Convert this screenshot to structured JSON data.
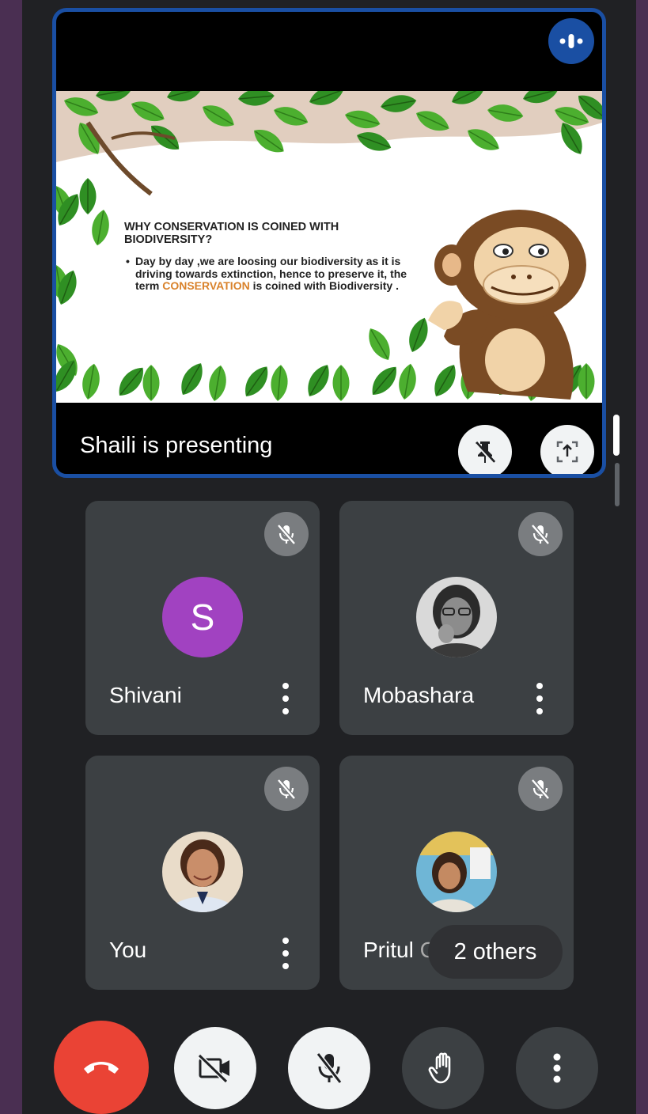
{
  "meeting": {
    "presenting_label": "Shaili is presenting"
  },
  "slide": {
    "title_line1": "WHY CONSERVATION IS COINED WITH",
    "title_line2": "BIODIVERSITY?",
    "bullet_marker": "•",
    "bullet_part1": "Day by day ,we are loosing our biodiversity as it is driving towards extinction, hence to preserve it, the term ",
    "bullet_accent": "CONSERVATION",
    "bullet_part2": " is coined with Biodiversity .",
    "accent_color": "#d9822b"
  },
  "participants": [
    {
      "name": "Shivani",
      "avatar_letter": "S",
      "avatar_color": "#a142c1",
      "muted": true
    },
    {
      "name": "Mobashara",
      "avatar": "photo",
      "muted": true
    },
    {
      "name": "You",
      "avatar": "photo",
      "muted": true
    },
    {
      "name": "Pritul",
      "name_suffix": "Ch",
      "avatar": "photo",
      "muted": true
    }
  ],
  "others_pill": "2 others",
  "icons": {
    "speaking": "speaking-indicator-icon",
    "unpin": "unpin-icon",
    "fullscreen": "fullscreen-icon",
    "mic_off": "mic-off-icon",
    "more": "more-vert-icon",
    "end_call": "end-call-icon",
    "camera_off": "camera-off-icon",
    "raise_hand": "raise-hand-icon"
  },
  "colors": {
    "accent_blue": "#1a4fa3",
    "end_call_red": "#ea4335",
    "tile_bg": "#3c4043",
    "app_bg": "#202124"
  }
}
